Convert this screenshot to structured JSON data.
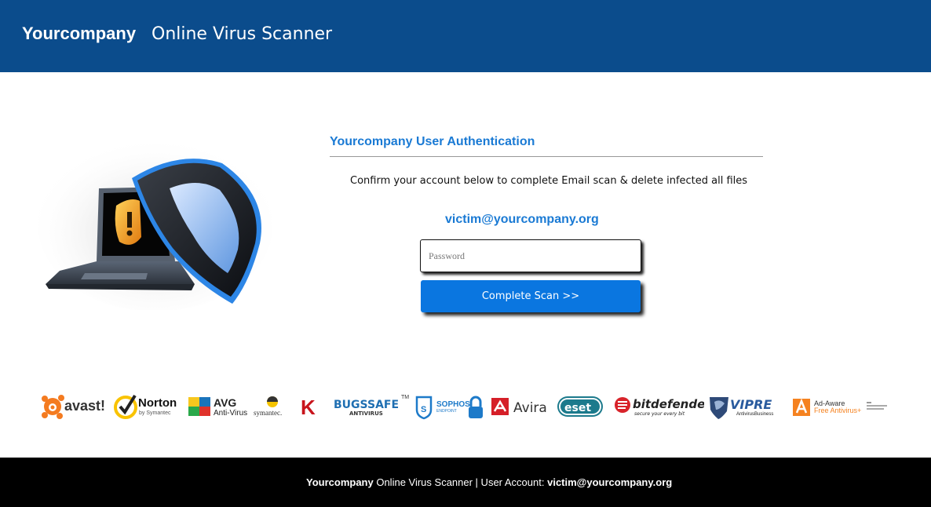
{
  "header": {
    "brand": "Yourcompany",
    "title": "Online Virus Scanner"
  },
  "hero": {
    "icon": "laptop-shield-icon"
  },
  "auth": {
    "heading": "Yourcompany User Authentication",
    "message": "Confirm your account below to complete Email scan & delete infected all files",
    "email": "victim@yourcompany.org",
    "password_placeholder": "Password",
    "password_value": "",
    "submit_label": "Complete Scan >>"
  },
  "logos": [
    {
      "name": "avast",
      "text": "avast!"
    },
    {
      "name": "norton",
      "text": "Norton",
      "sub": "by Symantec"
    },
    {
      "name": "avg",
      "text": "AVG",
      "sub": "Anti-Virus"
    },
    {
      "name": "symantec",
      "text": "symantec."
    },
    {
      "name": "kaspersky",
      "text": "K"
    },
    {
      "name": "bugssafe",
      "text": "BUGSSAFE",
      "sub": "ANTIVIRUS",
      "tm": "TM"
    },
    {
      "name": "sophos",
      "text": "SOPHOS",
      "sub": "ENDPOINT"
    },
    {
      "name": "avira",
      "text": "Avira"
    },
    {
      "name": "eset",
      "text": "eset"
    },
    {
      "name": "bitdefender",
      "text": "bitdefender",
      "sub": "secure your every bit"
    },
    {
      "name": "vipre",
      "text": "VIPRE",
      "sub": "AntivirusBusiness"
    },
    {
      "name": "ad-aware",
      "text": "Ad-Aware",
      "sub": "Free Antivirus+"
    }
  ],
  "footer": {
    "brand": "Yourcompany",
    "text": "Online Virus Scanner | User Account:",
    "email": "victim@yourcompany.org"
  },
  "colors": {
    "header_bg": "#0b4c8c",
    "accent": "#1a7ad4",
    "button": "#0a76e0",
    "footer_bg": "#000000"
  }
}
